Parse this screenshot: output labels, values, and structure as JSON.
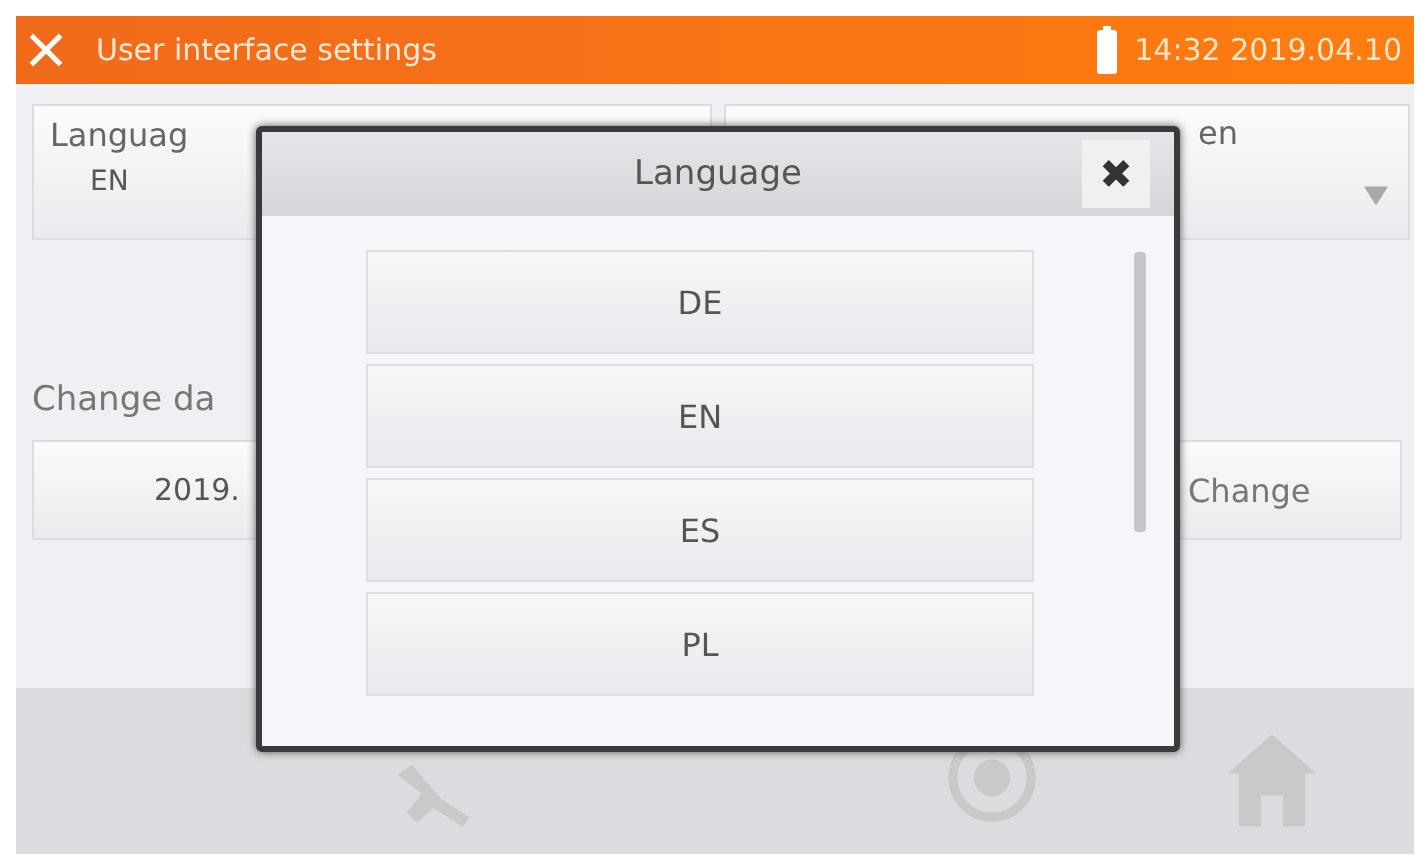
{
  "title_bar": {
    "title": "User interface settings",
    "time": "14:32 2019.04.10"
  },
  "settings": {
    "language": {
      "label": "Languag",
      "value": "EN"
    },
    "second_field": {
      "label": "en"
    },
    "date_label": "Change da",
    "date_value": "2019.",
    "change_button": "Change"
  },
  "dialog": {
    "title": "Language",
    "close": "✖",
    "options": [
      {
        "label": "DE",
        "selected": false
      },
      {
        "label": "EN",
        "selected": false
      },
      {
        "label": "ES",
        "selected": false
      },
      {
        "label": "PL",
        "selected": false
      }
    ]
  }
}
